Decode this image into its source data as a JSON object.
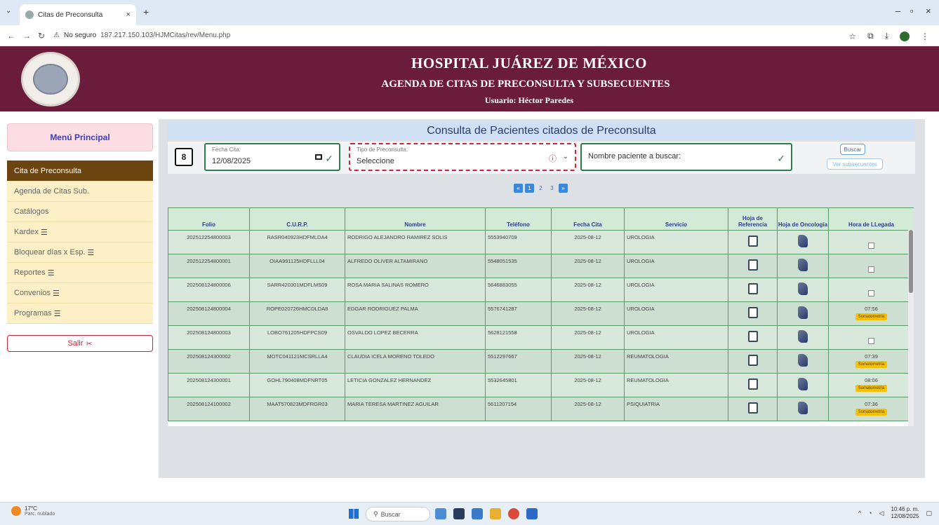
{
  "browser": {
    "tab_title": "Citas de Preconsulta",
    "tab_close": "×",
    "new_tab": "+",
    "not_secure": "No seguro",
    "url": "187.217.150.103/HJMCitas/rev/Menu.php"
  },
  "header": {
    "title": "HOSPITAL JUÁREZ DE MÉXICO",
    "subtitle": "AGENDA DE CITAS DE PRECONSULTA Y SUBSECUENTES",
    "user": "Usuario: Héctor Paredes"
  },
  "sidebar": {
    "title": "Menú Principal",
    "items": [
      {
        "label": "Cita de Preconsulta",
        "icon": ""
      },
      {
        "label": "Agenda de Citas Sub.",
        "icon": ""
      },
      {
        "label": "Catálogos",
        "icon": ""
      },
      {
        "label": "Kardex",
        "icon": "☰"
      },
      {
        "label": "Bloquear días x Esp.",
        "icon": "☰"
      },
      {
        "label": "Reportes",
        "icon": "☰"
      },
      {
        "label": "Convenios",
        "icon": "☰"
      },
      {
        "label": "Programas",
        "icon": "☰"
      }
    ],
    "logout": "Salir"
  },
  "main": {
    "title": "Consulta de Pacientes citados de Preconsulta",
    "date_label": "Fecha Cita:",
    "date_value": "12/08/2025",
    "type_label": "Tipo de Preconsulta:",
    "type_value": "Seleccione",
    "search_placeholder": "Nombre paciente a buscar:",
    "search_button": "Buscar",
    "subsequent_button": "Ver subsecuentes",
    "pages": [
      "1",
      "2",
      "3"
    ],
    "current_page": "1"
  },
  "table": {
    "headers": [
      "Folio",
      "C.U.R.P.",
      "Nombre",
      "Teléfono",
      "Fecha Cita",
      "Servicio",
      "Hoja de Referencia",
      "Hoja de Oncología",
      "Hora de LLegada"
    ],
    "badge_label": "Somatometría",
    "rows": [
      {
        "folio": "202512254800003",
        "curp": "RASR040923HDFMLDA4",
        "nombre": "RODRIGO ALEJANDRO RAMIREZ SOLIS",
        "telefono": "5553940709",
        "fecha": "2025-08-12",
        "servicio": "UROLOGIA",
        "llegada": ""
      },
      {
        "folio": "202512254800001",
        "curp": "OIAA991125HDFLLL04",
        "nombre": "ALFREDO OLIVER ALTAMIRANO",
        "telefono": "5548051535",
        "fecha": "2025-08-12",
        "servicio": "UROLOGIA",
        "llegada": ""
      },
      {
        "folio": "202508124800006",
        "curp": "SARR420301MDFLMS09",
        "nombre": "ROSA MARIA SALINAS ROMERO",
        "telefono": "5646883055",
        "fecha": "2025-08-12",
        "servicio": "UROLOGIA",
        "llegada": ""
      },
      {
        "folio": "202508124800004",
        "curp": "ROPE020726HMCDLDA8",
        "nombre": "EDGAR RODRIGUEZ PALMA",
        "telefono": "5576741287",
        "fecha": "2025-08-12",
        "servicio": "UROLOGIA",
        "llegada": "07:56"
      },
      {
        "folio": "202508124800003",
        "curp": "LOBO761205HDFPCS09",
        "nombre": "OSVALDO LOPEZ BECERRA",
        "telefono": "5628121558",
        "fecha": "2025-08-12",
        "servicio": "UROLOGIA",
        "llegada": ""
      },
      {
        "folio": "202508124300002",
        "curp": "MOTC041121MCSRLLA4",
        "nombre": "CLAUDIA ICELA MORENO TOLEDO",
        "telefono": "5512297667",
        "fecha": "2025-08-12",
        "servicio": "REUMATOLOGIA",
        "llegada": "07:39"
      },
      {
        "folio": "202508124300001",
        "curp": "GOHL790408MDFNRT05",
        "nombre": "LETICIA GONZALEZ HERNANDEZ",
        "telefono": "5532645801",
        "fecha": "2025-08-12",
        "servicio": "REUMATOLOGIA",
        "llegada": "08:06"
      },
      {
        "folio": "202508124100002",
        "curp": "MAAT570823MDFRGR03",
        "nombre": "MARIA TERESA MARTINEZ AGUILAR",
        "telefono": "5611207154",
        "fecha": "2025-08-12",
        "servicio": "PSIQUIATRIA",
        "llegada": "07:36"
      }
    ]
  },
  "taskbar": {
    "temp": "17°C",
    "weather": "Parc. nublado",
    "search": "Buscar",
    "time": "10:46 p. m.",
    "date": "12/08/2025"
  },
  "colors": {
    "header_bg": "#6a1c3a",
    "active_menu": "#6b4410",
    "menu_bg": "#fdf0c7",
    "accent_green": "#2e7d4f",
    "error_red": "#c9253d",
    "badge": "#f6c200"
  }
}
